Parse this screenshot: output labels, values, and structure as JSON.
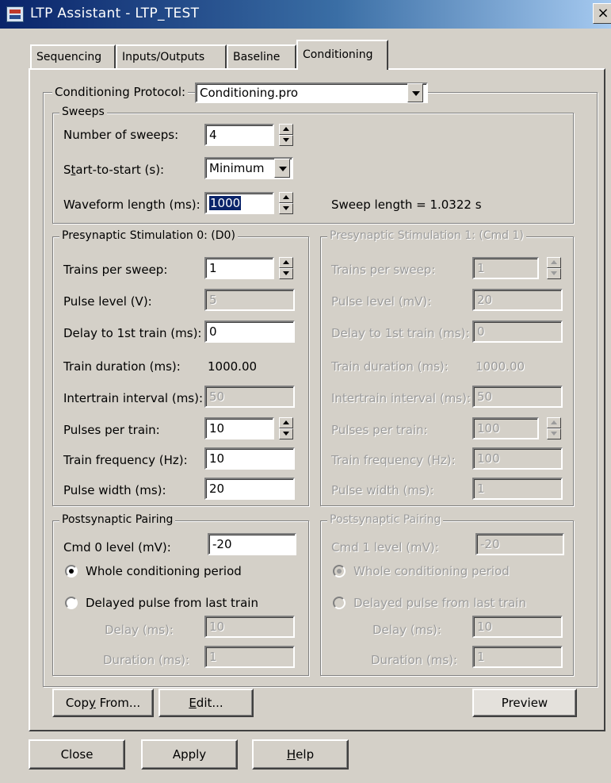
{
  "window": {
    "title": "LTP Assistant - LTP_TEST",
    "close_glyph": "×"
  },
  "tabs": [
    {
      "label": "Sequencing"
    },
    {
      "label": "Inputs/Outputs"
    },
    {
      "label": "Baseline"
    },
    {
      "label": "Conditioning"
    }
  ],
  "protocol": {
    "label": "Conditioning Protocol:",
    "value": "Conditioning.pro"
  },
  "sweeps": {
    "group_title": "Sweeps",
    "number_label": "Number of sweeps:",
    "number_value": "4",
    "start_label_pre": "S",
    "start_label_u": "t",
    "start_label_post": "art-to-start (s):",
    "start_value": "Minimum",
    "waveform_label": "Waveform length (ms):",
    "waveform_value": "1000",
    "sweep_length": "Sweep length = 1.0322 s"
  },
  "pre0": {
    "title": "Presynaptic Stimulation 0: (D0)",
    "trains_label": "Trains per sweep:",
    "trains_value": "1",
    "pulse_level_label": "Pulse level (V):",
    "pulse_level_value": "5",
    "delay_label": "Delay to 1st train (ms):",
    "delay_value": "0",
    "duration_label": "Train duration (ms):",
    "duration_value": "1000.00",
    "intertrain_label": "Intertrain interval (ms):",
    "intertrain_value": "50",
    "pulses_label": "Pulses per train:",
    "pulses_value": "10",
    "freq_label": "Train frequency (Hz):",
    "freq_value": "10",
    "width_label": "Pulse width (ms):",
    "width_value": "20"
  },
  "pre1": {
    "title": "Presynaptic Stimulation 1: (Cmd 1)",
    "trains_label": "Trains per sweep:",
    "trains_value": "1",
    "pulse_level_label": "Pulse level (mV):",
    "pulse_level_value": "20",
    "delay_label": "Delay to 1st train (ms):",
    "delay_value": "0",
    "duration_label": "Train duration (ms):",
    "duration_value": "1000.00",
    "intertrain_label": "Intertrain interval (ms):",
    "intertrain_value": "50",
    "pulses_label": "Pulses per train:",
    "pulses_value": "100",
    "freq_label": "Train frequency (Hz):",
    "freq_value": "100",
    "width_label": "Pulse width (ms):",
    "width_value": "1"
  },
  "post0": {
    "title": "Postsynaptic Pairing",
    "cmd_label": "Cmd 0 level (mV):",
    "cmd_value": "-20",
    "radio_whole": "Whole conditioning period",
    "radio_delayed": "Delayed pulse from last train",
    "delay_label": "Delay (ms):",
    "delay_value": "10",
    "duration_label": "Duration (ms):",
    "duration_value": "1"
  },
  "post1": {
    "title": "Postsynaptic Pairing",
    "cmd_label": "Cmd 1 level (mV):",
    "cmd_value": "-20",
    "radio_whole": "Whole conditioning period",
    "radio_delayed": "Delayed pulse from last train",
    "delay_label": "Delay (ms):",
    "delay_value": "10",
    "duration_label": "Duration (ms):",
    "duration_value": "1"
  },
  "buttons": {
    "copy_pre": "Cop",
    "copy_u": "y",
    "copy_post": " From...",
    "edit_u": "E",
    "edit_post": "dit...",
    "preview": "Preview",
    "close": "Close",
    "apply": "Apply",
    "help_u": "H",
    "help_post": "elp"
  }
}
